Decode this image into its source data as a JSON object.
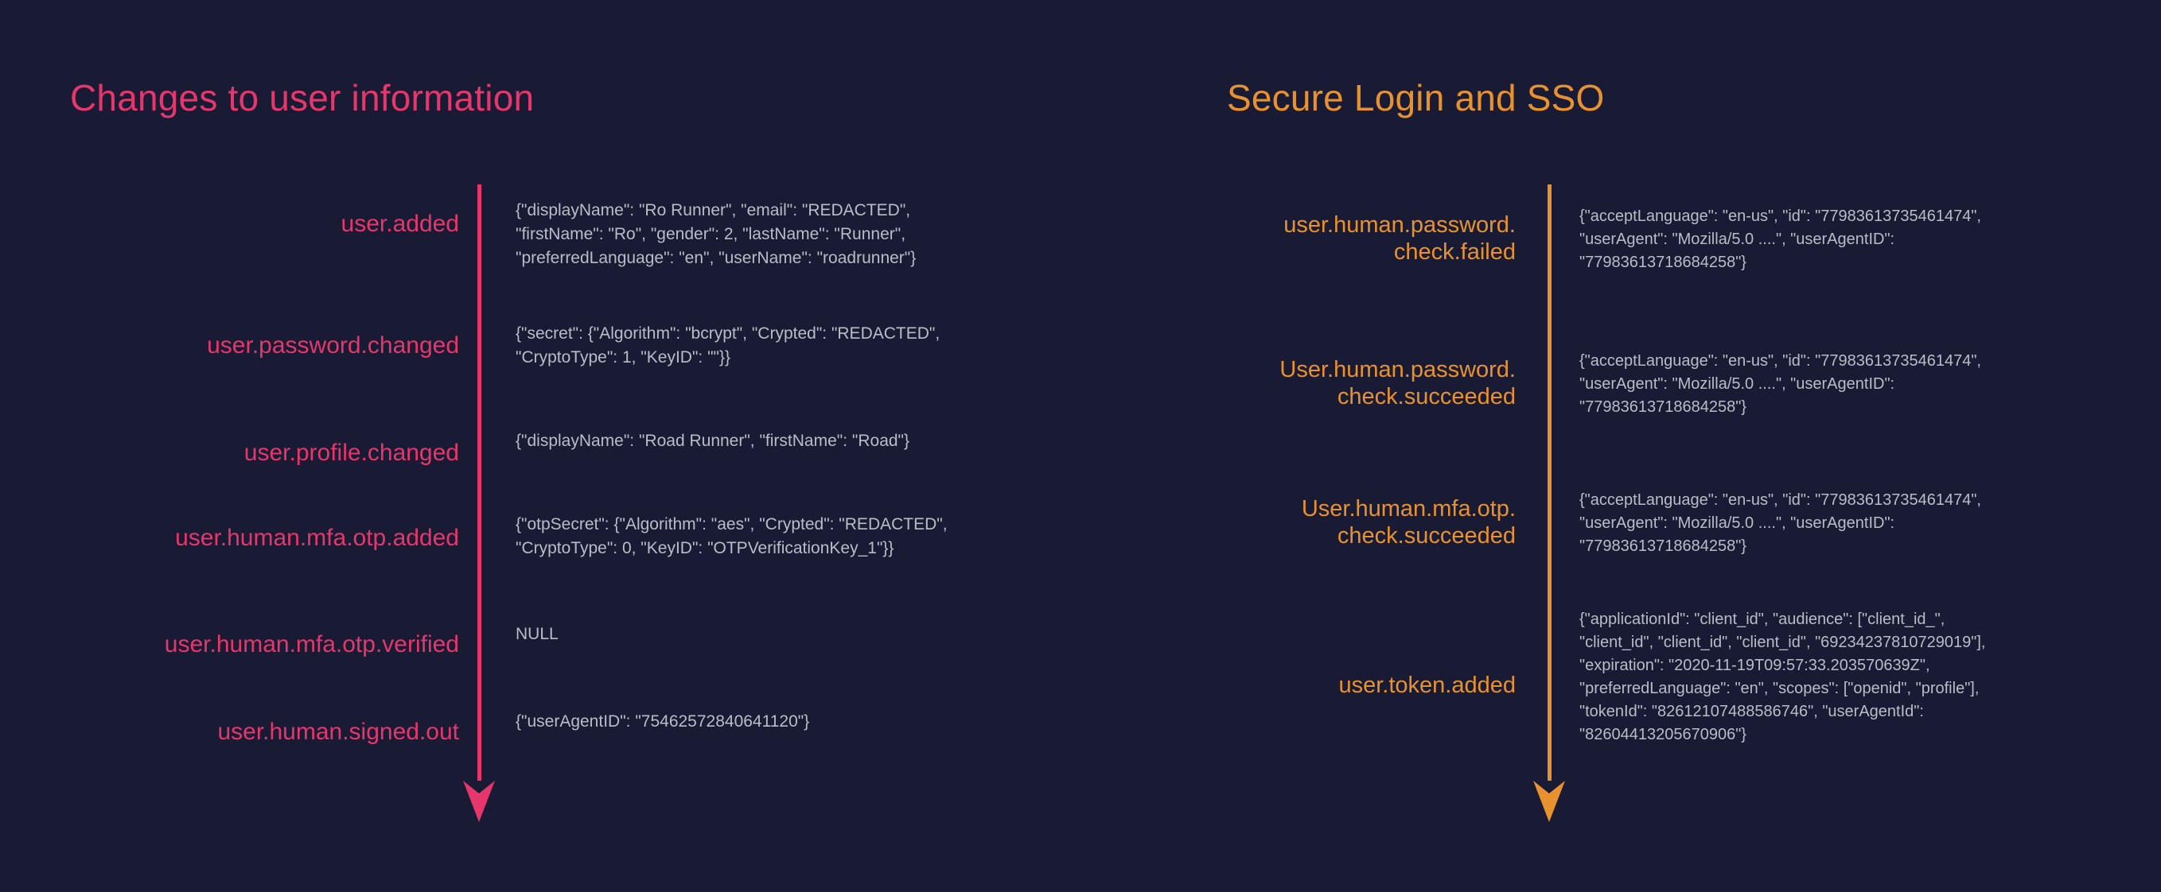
{
  "background_color": "#191a33",
  "columns": [
    {
      "id": "user-information",
      "title": "Changes to user information",
      "accent_color": "#e5376c",
      "json_color": "#b9bcc9",
      "arrow_icon": "arrow-down-icon",
      "events": [
        {
          "label": "user.added",
          "payload": "{\"displayName\": \"Ro Runner\", \"email\": \"REDACTED\",\n\"firstName\": \"Ro\", \"gender\": 2, \"lastName\": \"Runner\",\n\"preferredLanguage\": \"en\", \"userName\": \"roadrunner\"}"
        },
        {
          "label": "user.password.changed",
          "payload": "{\"secret\": {\"Algorithm\": \"bcrypt\", \"Crypted\": \"REDACTED\",\n\"CryptoType\": 1, \"KeyID\": \"\"}}"
        },
        {
          "label": "user.profile.changed",
          "payload": "{\"displayName\": \"Road Runner\", \"firstName\": \"Road\"}"
        },
        {
          "label": "user.human.mfa.otp.added",
          "payload": "{\"otpSecret\": {\"Algorithm\": \"aes\", \"Crypted\": \"REDACTED\",\n\"CryptoType\": 0, \"KeyID\": \"OTPVerificationKey_1\"}}"
        },
        {
          "label": "user.human.mfa.otp.verified",
          "payload": "NULL"
        },
        {
          "label": "user.human.signed.out",
          "payload": "{\"userAgentID\": \"75462572840641120\"}"
        }
      ]
    },
    {
      "id": "secure-login-sso",
      "title": "Secure Login and SSO",
      "accent_color": "#e8922f",
      "json_color": "#b9bcc9",
      "arrow_icon": "arrow-down-icon",
      "events": [
        {
          "label": "user.human.password.\ncheck.failed",
          "payload": "{\"acceptLanguage\": \"en-us\", \"id\": \"77983613735461474\",\n\"userAgent\": \"Mozilla/5.0 ....\", \"userAgentID\":\n\"77983613718684258\"}"
        },
        {
          "label": "User.human.password.\ncheck.succeeded",
          "payload": "{\"acceptLanguage\": \"en-us\", \"id\": \"77983613735461474\",\n\"userAgent\": \"Mozilla/5.0 ....\", \"userAgentID\":\n\"77983613718684258\"}"
        },
        {
          "label": "User.human.mfa.otp.\ncheck.succeeded",
          "payload": "{\"acceptLanguage\": \"en-us\", \"id\": \"77983613735461474\",\n\"userAgent\": \"Mozilla/5.0 ....\", \"userAgentID\":\n\"77983613718684258\"}"
        },
        {
          "label": "user.token.added",
          "payload": "{\"applicationId\": \"client_id\", \"audience\": [\"client_id_\",\n\"client_id\", \"client_id\", \"client_id\", \"69234237810729019\"],\n\"expiration\": \"2020-11-19T09:57:33.203570639Z\",\n\"preferredLanguage\": \"en\", \"scopes\": [\"openid\", \"profile\"],\n\"tokenId\": \"82612107488586746\", \"userAgentId\":\n\"82604413205670906\"}"
        }
      ]
    }
  ]
}
